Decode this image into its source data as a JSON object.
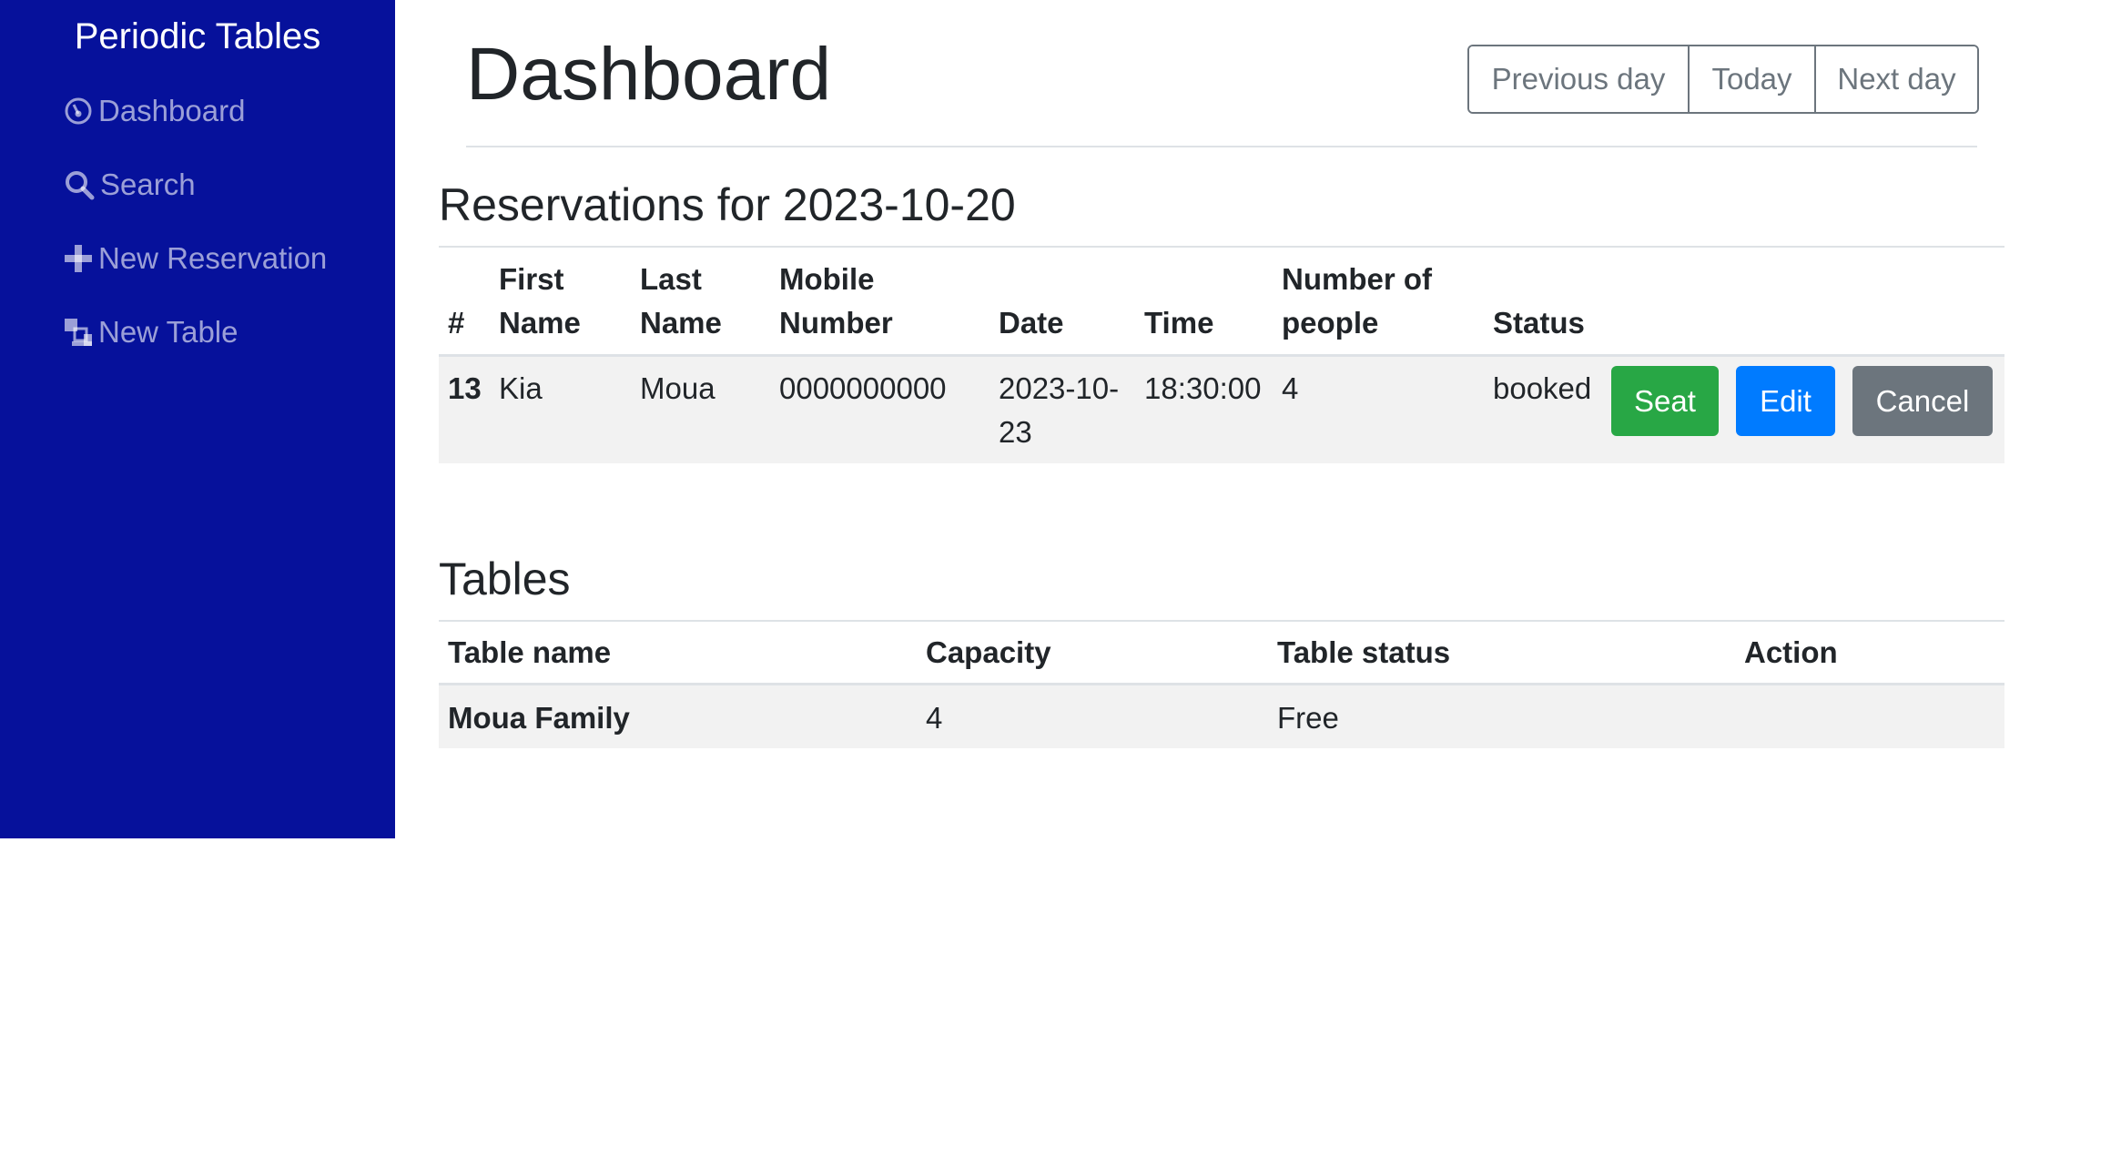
{
  "app": {
    "title": "Periodic Tables"
  },
  "sidebar": {
    "items": [
      {
        "label": "Dashboard",
        "icon": "dashboard-icon"
      },
      {
        "label": "Search",
        "icon": "search-icon"
      },
      {
        "label": "New Reservation",
        "icon": "plus-icon"
      },
      {
        "label": "New Table",
        "icon": "new-table-icon"
      }
    ]
  },
  "header": {
    "title": "Dashboard",
    "buttons": {
      "previous": "Previous day",
      "today": "Today",
      "next": "Next day"
    }
  },
  "reservations": {
    "title": "Reservations for 2023-10-20",
    "headers": {
      "number": "#",
      "first_name": [
        "First",
        "Name"
      ],
      "last_name": [
        "Last",
        "Name"
      ],
      "mobile": [
        "Mobile",
        "Number"
      ],
      "date": "Date",
      "time": "Time",
      "people": [
        "Number of",
        "people"
      ],
      "status": "Status"
    },
    "rows": [
      {
        "id": "13",
        "first_name": "Kia",
        "last_name": "Moua",
        "mobile": "0000000000",
        "date": [
          "2023-10-",
          "23"
        ],
        "time": "18:30:00",
        "people": "4",
        "status": "booked",
        "actions": {
          "seat": "Seat",
          "edit": "Edit",
          "cancel": "Cancel"
        }
      }
    ]
  },
  "tables": {
    "title": "Tables",
    "headers": {
      "name": "Table name",
      "capacity": "Capacity",
      "status": "Table status",
      "action": "Action"
    },
    "rows": [
      {
        "name": "Moua Family",
        "capacity": "4",
        "status": "Free"
      }
    ]
  },
  "colors": {
    "sidebar": "#06119b",
    "seat": "#28a745",
    "edit": "#007bff",
    "cancel": "#6c757d"
  }
}
